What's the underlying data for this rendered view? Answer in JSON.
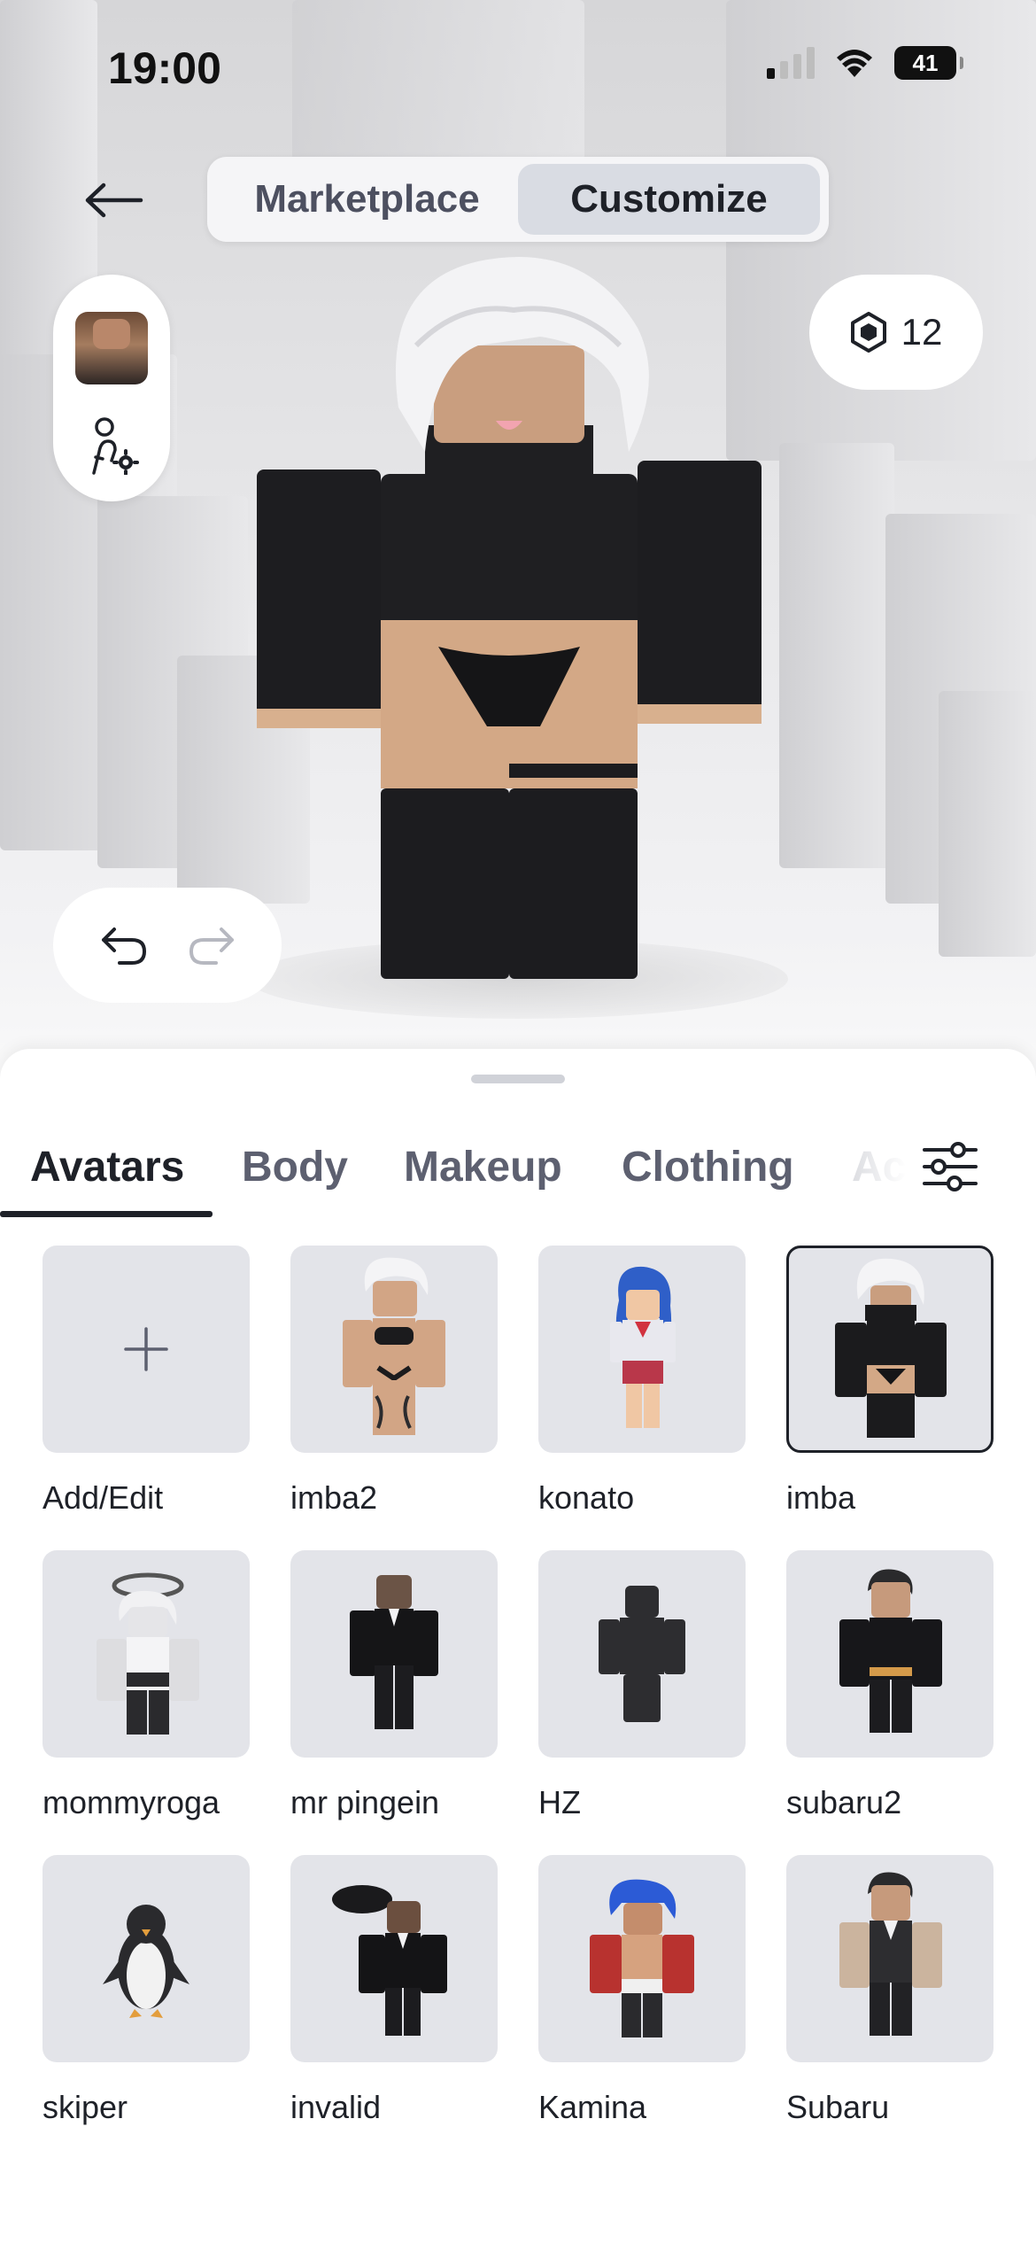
{
  "status_bar": {
    "time": "19:00",
    "battery": "41",
    "icons": [
      "cellular-signal-icon",
      "wifi-icon",
      "battery-icon"
    ]
  },
  "header": {
    "back_icon": "arrow-left-icon",
    "segments": [
      {
        "label": "Marketplace",
        "active": false
      },
      {
        "label": "Customize",
        "active": true
      }
    ]
  },
  "side_controls": {
    "avatar_icon": "avatar-thumbnail",
    "settings_icon": "avatar-settings-icon"
  },
  "currency": {
    "icon": "robux-icon",
    "amount": "12"
  },
  "history": {
    "undo_icon": "undo-icon",
    "redo_icon": "redo-icon"
  },
  "tabs": [
    {
      "label": "Avatars",
      "active": true
    },
    {
      "label": "Body",
      "active": false
    },
    {
      "label": "Makeup",
      "active": false
    },
    {
      "label": "Clothing",
      "active": false
    },
    {
      "label": "Ac",
      "active": false
    }
  ],
  "filter_icon": "sliders-icon",
  "avatars": [
    {
      "label": "Add/Edit",
      "type": "add",
      "selected": false
    },
    {
      "label": "imba2",
      "selected": false
    },
    {
      "label": "konato",
      "selected": false
    },
    {
      "label": "imba",
      "selected": true
    },
    {
      "label": "mommyroga",
      "selected": false
    },
    {
      "label": "mr pingein",
      "selected": false
    },
    {
      "label": "HZ",
      "selected": false
    },
    {
      "label": "subaru2",
      "selected": false
    },
    {
      "label": "skiper",
      "selected": false
    },
    {
      "label": "invalid",
      "selected": false
    },
    {
      "label": "Kamina",
      "selected": false
    },
    {
      "label": "Subaru",
      "selected": false
    }
  ],
  "colors": {
    "text_primary": "#1e2128",
    "text_secondary": "#5d6070",
    "tile_bg": "#e3e4e9",
    "segment_active": "#d9dce3"
  }
}
